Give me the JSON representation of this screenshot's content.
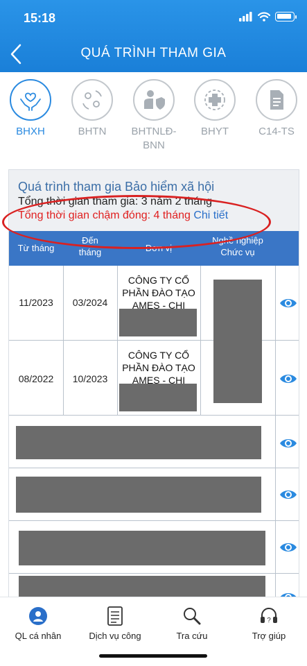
{
  "status_bar": {
    "time": "15:18"
  },
  "header": {
    "title": "QUÁ TRÌNH THAM GIA"
  },
  "tabs": [
    {
      "label": "BHXH",
      "icon": "hands-heart-icon",
      "active": true
    },
    {
      "label": "BHTN",
      "icon": "people-exchange-icon"
    },
    {
      "label": "BHTNLĐ-\nBNN",
      "icon": "worker-shield-icon"
    },
    {
      "label": "BHYT",
      "icon": "medical-cross-icon"
    },
    {
      "label": "C14-TS",
      "icon": "document-icon"
    }
  ],
  "summary": {
    "title": "Quá trình tham gia Bảo hiểm xã hội",
    "total_label": "Tổng thời gian tham gia: 3 năm 2 tháng",
    "late_label": "Tổng thời gian chậm đóng: 4 tháng",
    "detail_link": "Chi tiết"
  },
  "table": {
    "headers": {
      "from": "Từ tháng",
      "to": "Đến\ntháng",
      "unit": "Đơn vị",
      "job": "Nghề nghiệp\nChức vụ"
    },
    "rows": [
      {
        "from": "11/2023",
        "to": "03/2024",
        "unit": "CÔNG TY CỔ PHẦN ĐÀO TẠO AMES - CHI"
      },
      {
        "from": "08/2022",
        "to": "10/2023",
        "unit": "CÔNG TY CỔ PHẦN ĐÀO TẠO AMES - CHI"
      }
    ]
  },
  "bottom_nav": [
    {
      "label": "QL cá nhân",
      "icon": "personal-icon"
    },
    {
      "label": "Dịch vụ công",
      "icon": "public-service-icon"
    },
    {
      "label": "Tra cứu",
      "icon": "search-lookup-icon"
    },
    {
      "label": "Trợ giúp",
      "icon": "help-headset-icon"
    }
  ],
  "colors": {
    "header": "#1a7fd8",
    "accent": "#2a8ae0",
    "late_text": "#e02020",
    "table_header": "#3a76c6"
  }
}
